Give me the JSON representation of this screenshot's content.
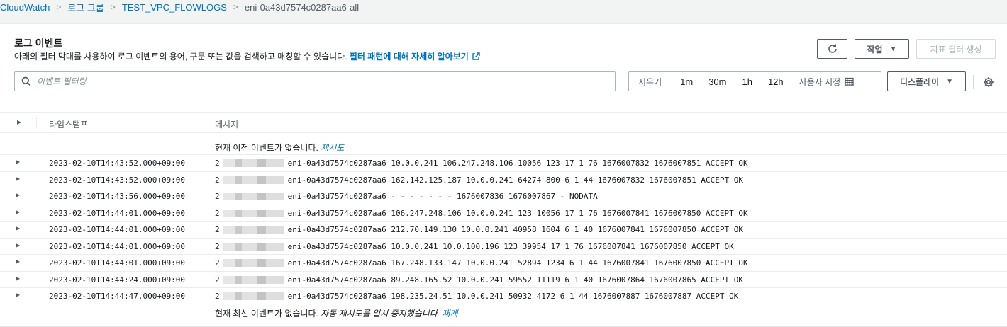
{
  "breadcrumb": {
    "items": [
      "CloudWatch",
      "로그 그룹",
      "TEST_VPC_FLOWLOGS"
    ],
    "current": "eni-0a43d7574c0287aa6-all"
  },
  "header": {
    "title": "로그 이벤트",
    "description": "아래의 필터 막대를 사용하여 로그 이벤트의 용어, 구문 또는 값을 검색하고 매칭할 수 있습니다.",
    "learn_more": "필터 패턴에 대해 자세히 알아보기"
  },
  "actions": {
    "refresh_icon": "refresh-icon",
    "actions_label": "작업",
    "create_metric_filter": "지표 필터 생성"
  },
  "search": {
    "placeholder": "이벤트 필터링"
  },
  "time_range": {
    "clear": "지우기",
    "options": [
      "1m",
      "30m",
      "1h",
      "12h"
    ],
    "custom": "사용자 지정"
  },
  "display_label": "디스플레이",
  "columns": {
    "timestamp": "타임스탬프",
    "message": "메시지"
  },
  "notices": {
    "top_text": "현재 이전 이벤트가 없습니다.",
    "top_link": "재시도",
    "bottom_text": "현재 최신 이벤트가 없습니다.",
    "bottom_em": "자동 재시도를 일시 중지했습니다.",
    "bottom_link": "재개"
  },
  "rows": [
    {
      "ts": "2023-02-10T14:43:52.000+09:00",
      "prefix": "2",
      "msg": "eni-0a43d7574c0287aa6 10.0.0.241 106.247.248.106 10056 123 17 1 76 1676007832 1676007851 ACCEPT OK"
    },
    {
      "ts": "2023-02-10T14:43:52.000+09:00",
      "prefix": "2",
      "msg": "eni-0a43d7574c0287aa6 162.142.125.187 10.0.0.241 64274 800 6 1 44 1676007832 1676007851 ACCEPT OK"
    },
    {
      "ts": "2023-02-10T14:43:56.000+09:00",
      "prefix": "2",
      "msg": "eni-0a43d7574c0287aa6 - - - - - - - 1676007836 1676007867 - NODATA"
    },
    {
      "ts": "2023-02-10T14:44:01.000+09:00",
      "prefix": "2",
      "msg": "eni-0a43d7574c0287aa6 106.247.248.106 10.0.0.241 123 10056 17 1 76 1676007841 1676007850 ACCEPT OK"
    },
    {
      "ts": "2023-02-10T14:44:01.000+09:00",
      "prefix": "2",
      "msg": "eni-0a43d7574c0287aa6 212.70.149.130 10.0.0.241 40958 1604 6 1 40 1676007841 1676007850 ACCEPT OK"
    },
    {
      "ts": "2023-02-10T14:44:01.000+09:00",
      "prefix": "2",
      "msg": "eni-0a43d7574c0287aa6 10.0.0.241 10.0.100.196 123 39954 17 1 76 1676007841 1676007850 ACCEPT OK"
    },
    {
      "ts": "2023-02-10T14:44:01.000+09:00",
      "prefix": "2",
      "msg": "eni-0a43d7574c0287aa6 167.248.133.147 10.0.0.241 52894 1234 6 1 44 1676007841 1676007850 ACCEPT OK"
    },
    {
      "ts": "2023-02-10T14:44:24.000+09:00",
      "prefix": "2",
      "msg": "eni-0a43d7574c0287aa6 89.248.165.52 10.0.0.241 59552 11119 6 1 40 1676007864 1676007865 ACCEPT OK"
    },
    {
      "ts": "2023-02-10T14:44:47.000+09:00",
      "prefix": "2",
      "msg": "eni-0a43d7574c0287aa6 198.235.24.51 10.0.0.241 50932 4172 6 1 44 1676007887 1676007887 ACCEPT OK"
    }
  ]
}
